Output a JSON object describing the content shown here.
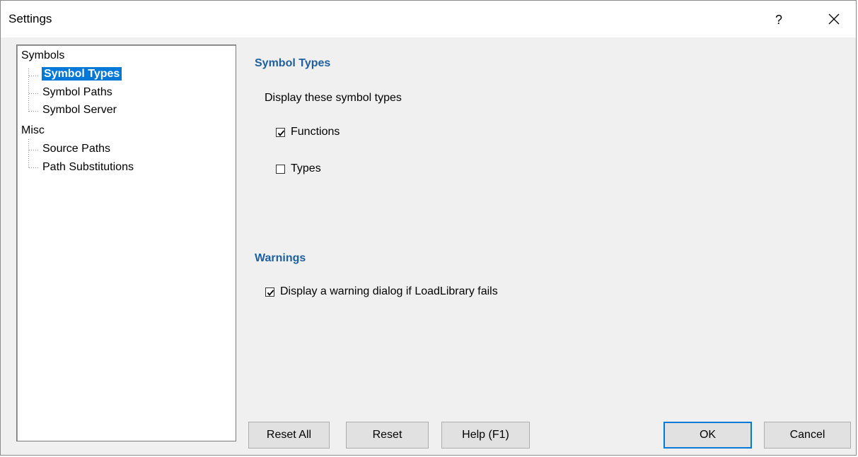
{
  "window": {
    "title": "Settings",
    "help_glyph": "?",
    "close_icon": "close-icon"
  },
  "tree": {
    "nodes": [
      {
        "label": "Symbols",
        "level": 0,
        "selected": false
      },
      {
        "label": "Symbol Types",
        "level": 1,
        "selected": true
      },
      {
        "label": "Symbol Paths",
        "level": 1,
        "selected": false
      },
      {
        "label": "Symbol Server",
        "level": 1,
        "selected": false
      },
      {
        "label": "Misc",
        "level": 0,
        "selected": false
      },
      {
        "label": "Source Paths",
        "level": 1,
        "selected": false
      },
      {
        "label": "Path Substitutions",
        "level": 1,
        "selected": false
      }
    ]
  },
  "symbol_types": {
    "heading": "Symbol Types",
    "prompt": "Display these symbol types",
    "functions": {
      "label": "Functions",
      "checked": true
    },
    "types": {
      "label": "Types",
      "checked": false
    }
  },
  "warnings": {
    "heading": "Warnings",
    "loadlibrary": {
      "label": "Display a warning dialog if LoadLibrary fails",
      "checked": true
    }
  },
  "buttons": {
    "reset_all": "Reset All",
    "reset": "Reset",
    "help": "Help (F1)",
    "ok": "OK",
    "cancel": "Cancel"
  },
  "colors": {
    "heading": "#1f5f9f",
    "selection": "#0078d7",
    "dialog_bg": "#f0f0f0"
  }
}
